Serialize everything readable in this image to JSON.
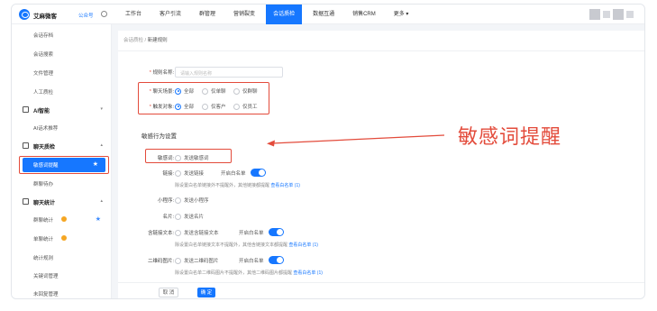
{
  "app": {
    "brand": "艾麻微客",
    "brand_sub": "公众号"
  },
  "nav": [
    "工作台",
    "客户引流",
    "群管理",
    "营销裂变",
    "会话质检",
    "数据互通",
    "销售CRM",
    "更多 ▾"
  ],
  "sidebar": {
    "items": [
      {
        "label": "会话存档"
      },
      {
        "label": "会话搜索"
      },
      {
        "label": "文件管理"
      },
      {
        "label": "人工质检"
      },
      {
        "label": "AI智能",
        "chev": "▾"
      },
      {
        "label": "AI话术推荐"
      },
      {
        "label": "聊天质检",
        "chev": "▴"
      },
      {
        "label": "敏感词提醒",
        "star": "★"
      },
      {
        "label": "群聊待办"
      },
      {
        "label": "聊天统计",
        "chev": "▴"
      },
      {
        "label": "群聊统计",
        "star": "★"
      },
      {
        "label": "单聊统计"
      },
      {
        "label": "统计规则"
      },
      {
        "label": "关键词管理"
      },
      {
        "label": "未回复管理"
      }
    ]
  },
  "breadcrumb": {
    "parent": "会话质检",
    "sep": "/",
    "current": "新建规则"
  },
  "form": {
    "rule_name_label": "规则名称:",
    "rule_name_placeholder": "请输入规则名称",
    "chat_scene_label": "聊天场景:",
    "chat_scene_options": [
      "全部",
      "仅单聊",
      "仅群聊"
    ],
    "trigger_label": "触发对象:",
    "trigger_options": [
      "全部",
      "仅客户",
      "仅员工"
    ],
    "section_title": "敏感行为设置",
    "sensitive_word_label": "敏感词:",
    "sensitive_word_option": "发送敏感词",
    "link_label": "链接:",
    "link_option": "发送链接",
    "link_whitelist": "开启白名单",
    "link_note": "除设置白名单链接外不提醒外，其他链接都提醒",
    "link_note_link": "查看白名单 (1)",
    "miniprogram_label": "小程序:",
    "miniprogram_option": "发送小程序",
    "card_label": "名片:",
    "card_option": "发送名片",
    "linktext_label": "含链接文本:",
    "linktext_option": "发送含链接文本",
    "linktext_whitelist": "开启白名单",
    "linktext_note": "除设置白名单链接文本不提醒外，其他含链接文本都提醒",
    "linktext_note_link": "查看白名单 (1)",
    "qrcode_label": "二维码图片:",
    "qrcode_option": "发送二维码图片",
    "qrcode_whitelist": "开启白名单",
    "qrcode_note": "除设置白名单二维码图片不提醒外，其他二维码图片都提醒",
    "qrcode_note_link": "查看白名单 (1)"
  },
  "buttons": {
    "cancel": "取 消",
    "ok": "确 定"
  },
  "annotation": "敏感词提醒",
  "colors": {
    "accent": "#1677ff",
    "annotation": "#e34b3b"
  }
}
